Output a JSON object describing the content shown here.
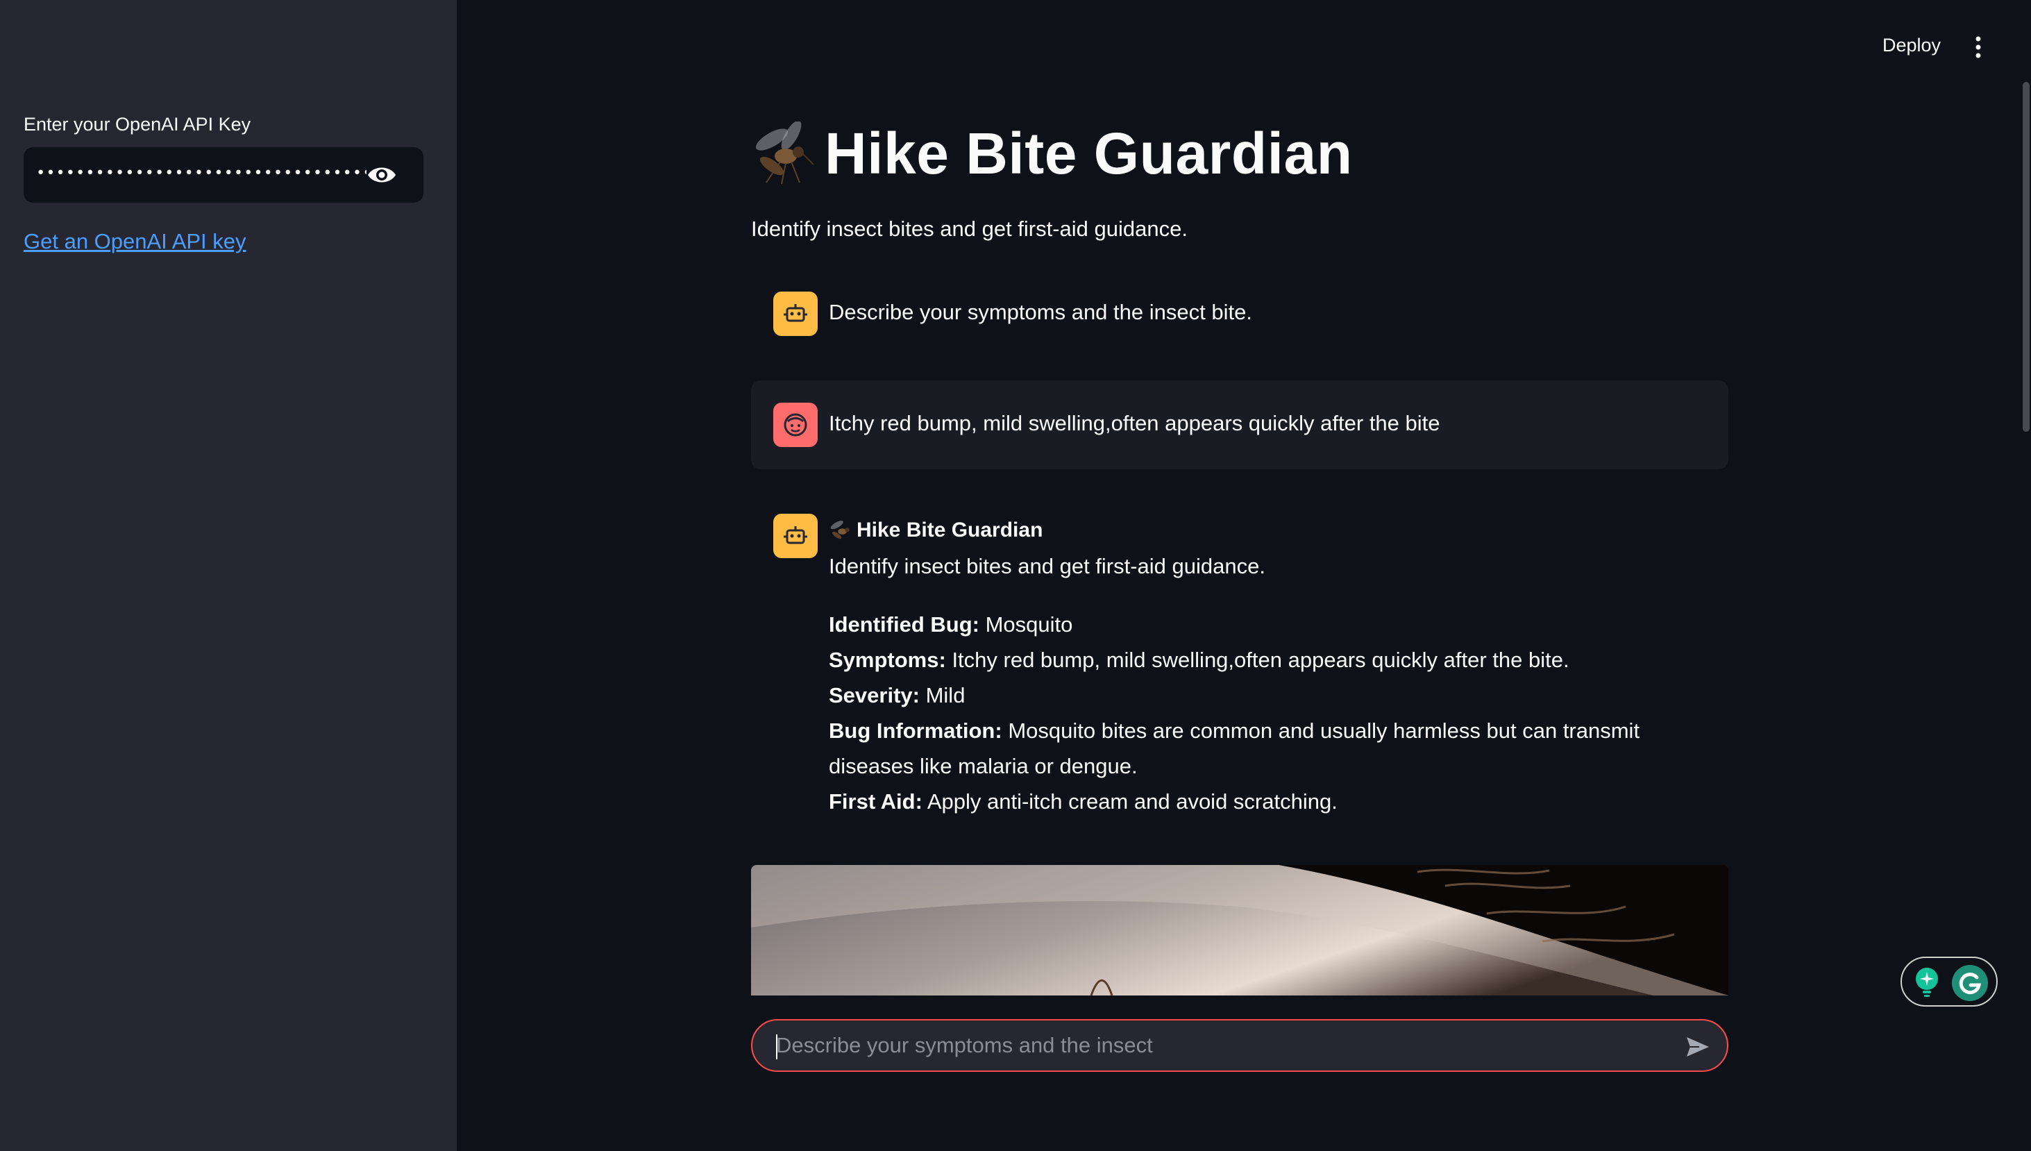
{
  "sidebar": {
    "api_label": "Enter your OpenAI API Key",
    "api_value": "••••••••••••••••••••••••••••••••••••••••••••••••••••••",
    "api_link": "Get an OpenAI API key"
  },
  "header": {
    "deploy_label": "Deploy",
    "menu_icon": "kebab-menu-icon"
  },
  "main": {
    "title": "Hike Bite Guardian",
    "subtitle": "Identify insect bites and get first-aid guidance.",
    "messages": [
      {
        "role": "assistant",
        "avatar_icon": "robot-icon",
        "text": "Describe your symptoms and the insect bite."
      },
      {
        "role": "user",
        "avatar_icon": "face-icon",
        "text": "Itchy red bump, mild swelling,often appears quickly after the bite"
      }
    ],
    "response": {
      "avatar_icon": "robot-icon",
      "name": "Hike Bite Guardian",
      "subtitle": "Identify insect bites and get first-aid guidance.",
      "identified_bug_label": "Identified Bug:",
      "identified_bug_value": "Mosquito",
      "symptoms_label": "Symptoms:",
      "symptoms_value": "Itchy red bump, mild swelling,often appears quickly after the bite.",
      "severity_label": "Severity:",
      "severity_value": "Mild",
      "bug_info_label": "Bug Information:",
      "bug_info_value": "Mosquito bites are common and usually harmless but can transmit diseases like malaria or dengue.",
      "first_aid_label": "First Aid:",
      "first_aid_value": "Apply anti-itch cream and avoid scratching."
    }
  },
  "chat_input": {
    "placeholder": "Describe your symptoms and the insect",
    "send_icon": "send-icon"
  },
  "colors": {
    "background": "#0e1117",
    "sidebar": "#262730",
    "assistant_avatar": "#ffbd45",
    "user_avatar": "#ff6c6c",
    "link": "#4a9eff",
    "input_border": "#ff4b4b"
  }
}
